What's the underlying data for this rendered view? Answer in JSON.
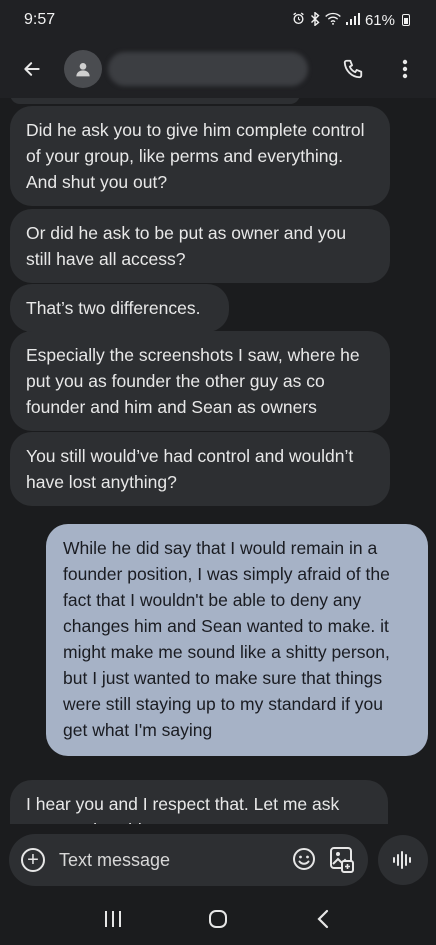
{
  "status_bar": {
    "time": "9:57",
    "battery": "61%",
    "icons": [
      "alarm-icon",
      "bluetooth-icon",
      "wifi-icon",
      "signal-icon",
      "battery-icon"
    ]
  },
  "app_bar": {
    "contact_name": "",
    "icons": [
      "back-arrow-icon",
      "person-icon",
      "phone-icon",
      "more-vert-icon"
    ]
  },
  "messages": [
    {
      "direction": "incoming",
      "text": "Did he ask you to give him complete control of your group, like perms and everything. And shut you out?"
    },
    {
      "direction": "incoming",
      "text": "Or did he ask to be put as owner and you still have all access?"
    },
    {
      "direction": "incoming",
      "text": "That’s two differences."
    },
    {
      "direction": "incoming",
      "text": "Especially the screenshots I saw, where he put you as founder the other guy as co founder and him and Sean as owners"
    },
    {
      "direction": "incoming",
      "text": "You still would’ve had control and wouldn’t have lost anything?"
    },
    {
      "direction": "outgoing",
      "text": "While he did say that I would remain in a founder position, I was simply afraid of the fact that I wouldn't be able to deny any changes him and Sean wanted to make. it might make me sound like a shitty person, but I just wanted to make sure that things were still staying up to my standard if you get what I'm saying"
    },
    {
      "direction": "incoming",
      "text": "I hear you and I respect that. Let me ask you another thing"
    }
  ],
  "compose": {
    "placeholder": "Text message",
    "value": ""
  },
  "colors": {
    "background": "#1b1c1e",
    "incoming_bubble": "#2d2f32",
    "outgoing_bubble": "#a6b2c6"
  }
}
